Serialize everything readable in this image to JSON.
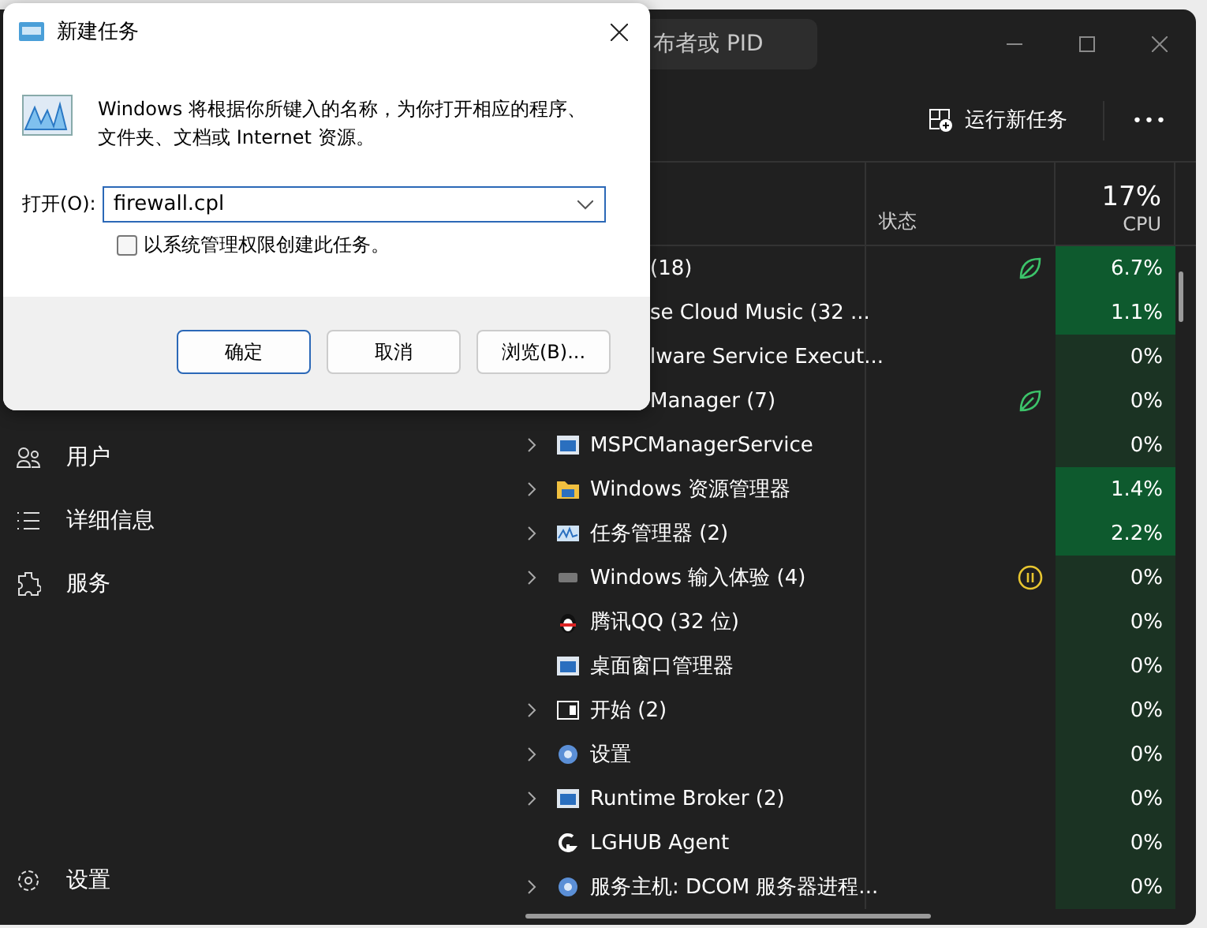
{
  "task_manager": {
    "search": {
      "placeholder": "布者或 PID"
    },
    "sidebar": {
      "items": [
        {
          "label": "用户",
          "kind": "users"
        },
        {
          "label": "详细信息",
          "kind": "list"
        },
        {
          "label": "服务",
          "kind": "puzzle"
        }
      ],
      "footer": {
        "label": "设置"
      }
    },
    "toolbar": {
      "run_task": "运行新任务",
      "more": "•••"
    },
    "table": {
      "columns": [
        {
          "label": "状态"
        },
        {
          "label": "CPU",
          "total": "17%"
        }
      ],
      "rows": [
        {
          "kind": "covered",
          "name": "(18)",
          "eco": true,
          "paused": false,
          "cpu": "6.7%",
          "highlight": true
        },
        {
          "kind": "covered",
          "name": "se Cloud Music (32 ...",
          "eco": false,
          "paused": false,
          "cpu": "1.1%",
          "highlight": true
        },
        {
          "kind": "covered",
          "name": "lware Service Execut...",
          "eco": false,
          "paused": false,
          "cpu": "0%",
          "highlight": false
        },
        {
          "kind": "covered",
          "name": "Manager (7)",
          "eco": true,
          "paused": false,
          "cpu": "0%",
          "highlight": false
        },
        {
          "kind": "app",
          "expandable": true,
          "name": "MSPCManagerService",
          "eco": false,
          "paused": false,
          "cpu": "0%",
          "highlight": false
        },
        {
          "kind": "folder",
          "expandable": true,
          "name": "Windows 资源管理器",
          "eco": false,
          "paused": false,
          "cpu": "1.4%",
          "highlight": true
        },
        {
          "kind": "chart",
          "expandable": true,
          "name": "任务管理器 (2)",
          "eco": false,
          "paused": false,
          "cpu": "2.2%",
          "highlight": true
        },
        {
          "kind": "keyboard",
          "expandable": true,
          "name": "Windows 输入体验 (4)",
          "eco": false,
          "paused": true,
          "cpu": "0%",
          "highlight": false
        },
        {
          "kind": "penguin",
          "expandable": false,
          "name": "腾讯QQ (32 位)",
          "eco": false,
          "paused": false,
          "cpu": "0%",
          "highlight": false
        },
        {
          "kind": "app",
          "expandable": false,
          "name": "桌面窗口管理器",
          "eco": false,
          "paused": false,
          "cpu": "0%",
          "highlight": false
        },
        {
          "kind": "window",
          "expandable": true,
          "name": "开始 (2)",
          "eco": false,
          "paused": false,
          "cpu": "0%",
          "highlight": false
        },
        {
          "kind": "gear",
          "expandable": true,
          "name": "设置",
          "eco": false,
          "paused": false,
          "cpu": "0%",
          "highlight": false
        },
        {
          "kind": "app",
          "expandable": true,
          "name": "Runtime Broker (2)",
          "eco": false,
          "paused": false,
          "cpu": "0%",
          "highlight": false
        },
        {
          "kind": "logo",
          "expandable": false,
          "name": "LGHUB Agent",
          "eco": false,
          "paused": false,
          "cpu": "0%",
          "highlight": false
        },
        {
          "kind": "gear",
          "expandable": true,
          "name": "服务主机: DCOM 服务器进程...",
          "eco": false,
          "paused": false,
          "cpu": "0%",
          "highlight": false
        }
      ]
    }
  },
  "dialog": {
    "title": "新建任务",
    "message": "Windows 将根据你所键入的名称，为你打开相应的程序、文件夹、文档或 Internet 资源。",
    "open_label": "打开(O):",
    "open_value": "firewall.cpl",
    "admin": {
      "label": "以系统管理权限创建此任务。",
      "checked": false
    },
    "buttons": [
      {
        "label": "确定",
        "default": true
      },
      {
        "label": "取消",
        "default": false
      },
      {
        "label": "浏览(B)...",
        "default": false
      }
    ]
  }
}
